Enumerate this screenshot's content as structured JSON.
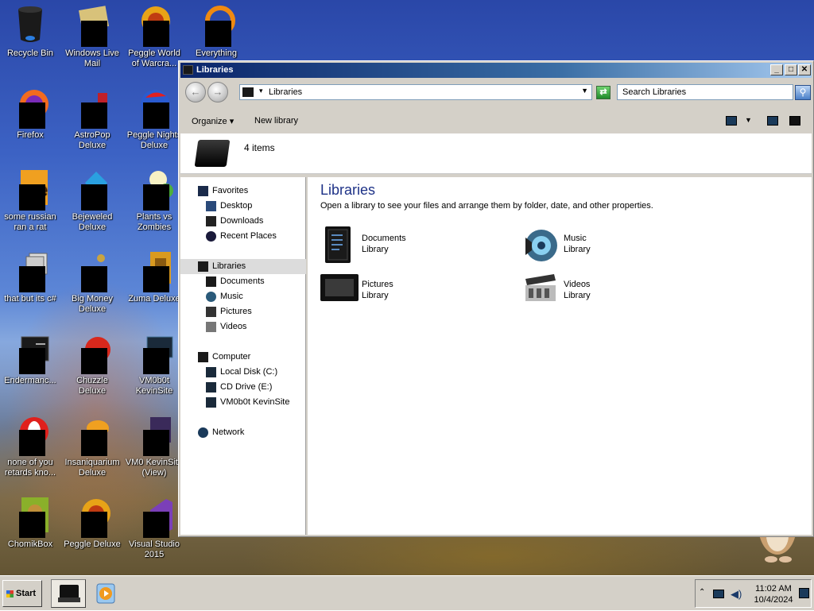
{
  "desktop": {
    "icons": [
      {
        "label": "Recycle Bin"
      },
      {
        "label": "Windows Live Mail"
      },
      {
        "label": "Peggle World of Warcra..."
      },
      {
        "label": "Everything"
      },
      {
        "label": "Firefox"
      },
      {
        "label": "AstroPop Deluxe"
      },
      {
        "label": "Peggle Nights Deluxe"
      },
      {
        "label": "some russian ran a rat"
      },
      {
        "label": "Bejeweled Deluxe"
      },
      {
        "label": "Plants vs Zombies"
      },
      {
        "label": "that but its c#"
      },
      {
        "label": "Big Money Deluxe"
      },
      {
        "label": "Zuma Deluxe"
      },
      {
        "label": "Endermanc..."
      },
      {
        "label": "Chuzzle Deluxe"
      },
      {
        "label": "VM0b0t KevinSite"
      },
      {
        "label": "none of you retards kno..."
      },
      {
        "label": "Insaniquarium Deluxe"
      },
      {
        "label": "VM0 KevinSite (View)"
      },
      {
        "label": "ChomikBox"
      },
      {
        "label": "Peggle Deluxe"
      },
      {
        "label": "Visual Studio 2015"
      }
    ]
  },
  "window": {
    "title": "Libraries",
    "address": "Libraries",
    "search_placeholder": "Search Libraries",
    "toolbar": {
      "organize": "Organize",
      "new_library": "New library"
    },
    "detail": {
      "count": "4 items"
    },
    "nav": {
      "favorites": "Favorites",
      "desktop": "Desktop",
      "downloads": "Downloads",
      "recent": "Recent Places",
      "libraries": "Libraries",
      "documents": "Documents",
      "music": "Music",
      "pictures": "Pictures",
      "videos": "Videos",
      "computer": "Computer",
      "local_disk": "Local Disk (C:)",
      "cd_drive": "CD Drive (E:)",
      "kevinsite": "VM0b0t KevinSite",
      "network": "Network"
    },
    "content": {
      "heading": "Libraries",
      "subtitle": "Open a library to see your files and arrange them by folder, date, and other properties.",
      "libraries": [
        {
          "name": "Documents",
          "type": "Library"
        },
        {
          "name": "Music",
          "type": "Library"
        },
        {
          "name": "Pictures",
          "type": "Library"
        },
        {
          "name": "Videos",
          "type": "Library"
        }
      ]
    }
  },
  "taskbar": {
    "start": "Start",
    "clock_time": "11:02 AM",
    "clock_date": "10/4/2024"
  }
}
